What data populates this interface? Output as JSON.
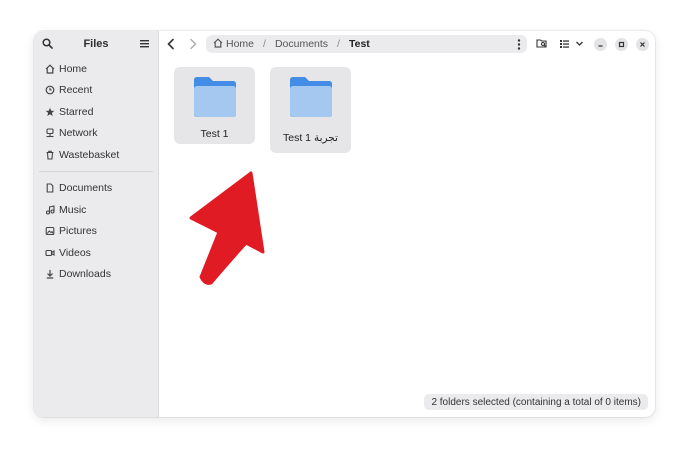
{
  "sidebar": {
    "title": "Files",
    "places": [
      {
        "label": "Home",
        "icon": "home-icon"
      },
      {
        "label": "Recent",
        "icon": "clock-icon"
      },
      {
        "label": "Starred",
        "icon": "star-icon"
      },
      {
        "label": "Network",
        "icon": "network-icon"
      },
      {
        "label": "Wastebasket",
        "icon": "trash-icon"
      }
    ],
    "bookmarks": [
      {
        "label": "Documents",
        "icon": "document-icon"
      },
      {
        "label": "Music",
        "icon": "music-icon"
      },
      {
        "label": "Pictures",
        "icon": "picture-icon"
      },
      {
        "label": "Videos",
        "icon": "video-icon"
      },
      {
        "label": "Downloads",
        "icon": "download-icon"
      }
    ]
  },
  "pathbar": {
    "crumbs": [
      "Home",
      "Documents",
      "Test"
    ],
    "separator": "/"
  },
  "items": [
    {
      "name": "Test 1"
    },
    {
      "name": "Test 1 تجربة"
    }
  ],
  "status": "2 folders selected (containing a total of 0 items)",
  "colors": {
    "accent_arrow": "#e01b24",
    "folder_back": "#438de6",
    "folder_front": "#99c1f1"
  }
}
